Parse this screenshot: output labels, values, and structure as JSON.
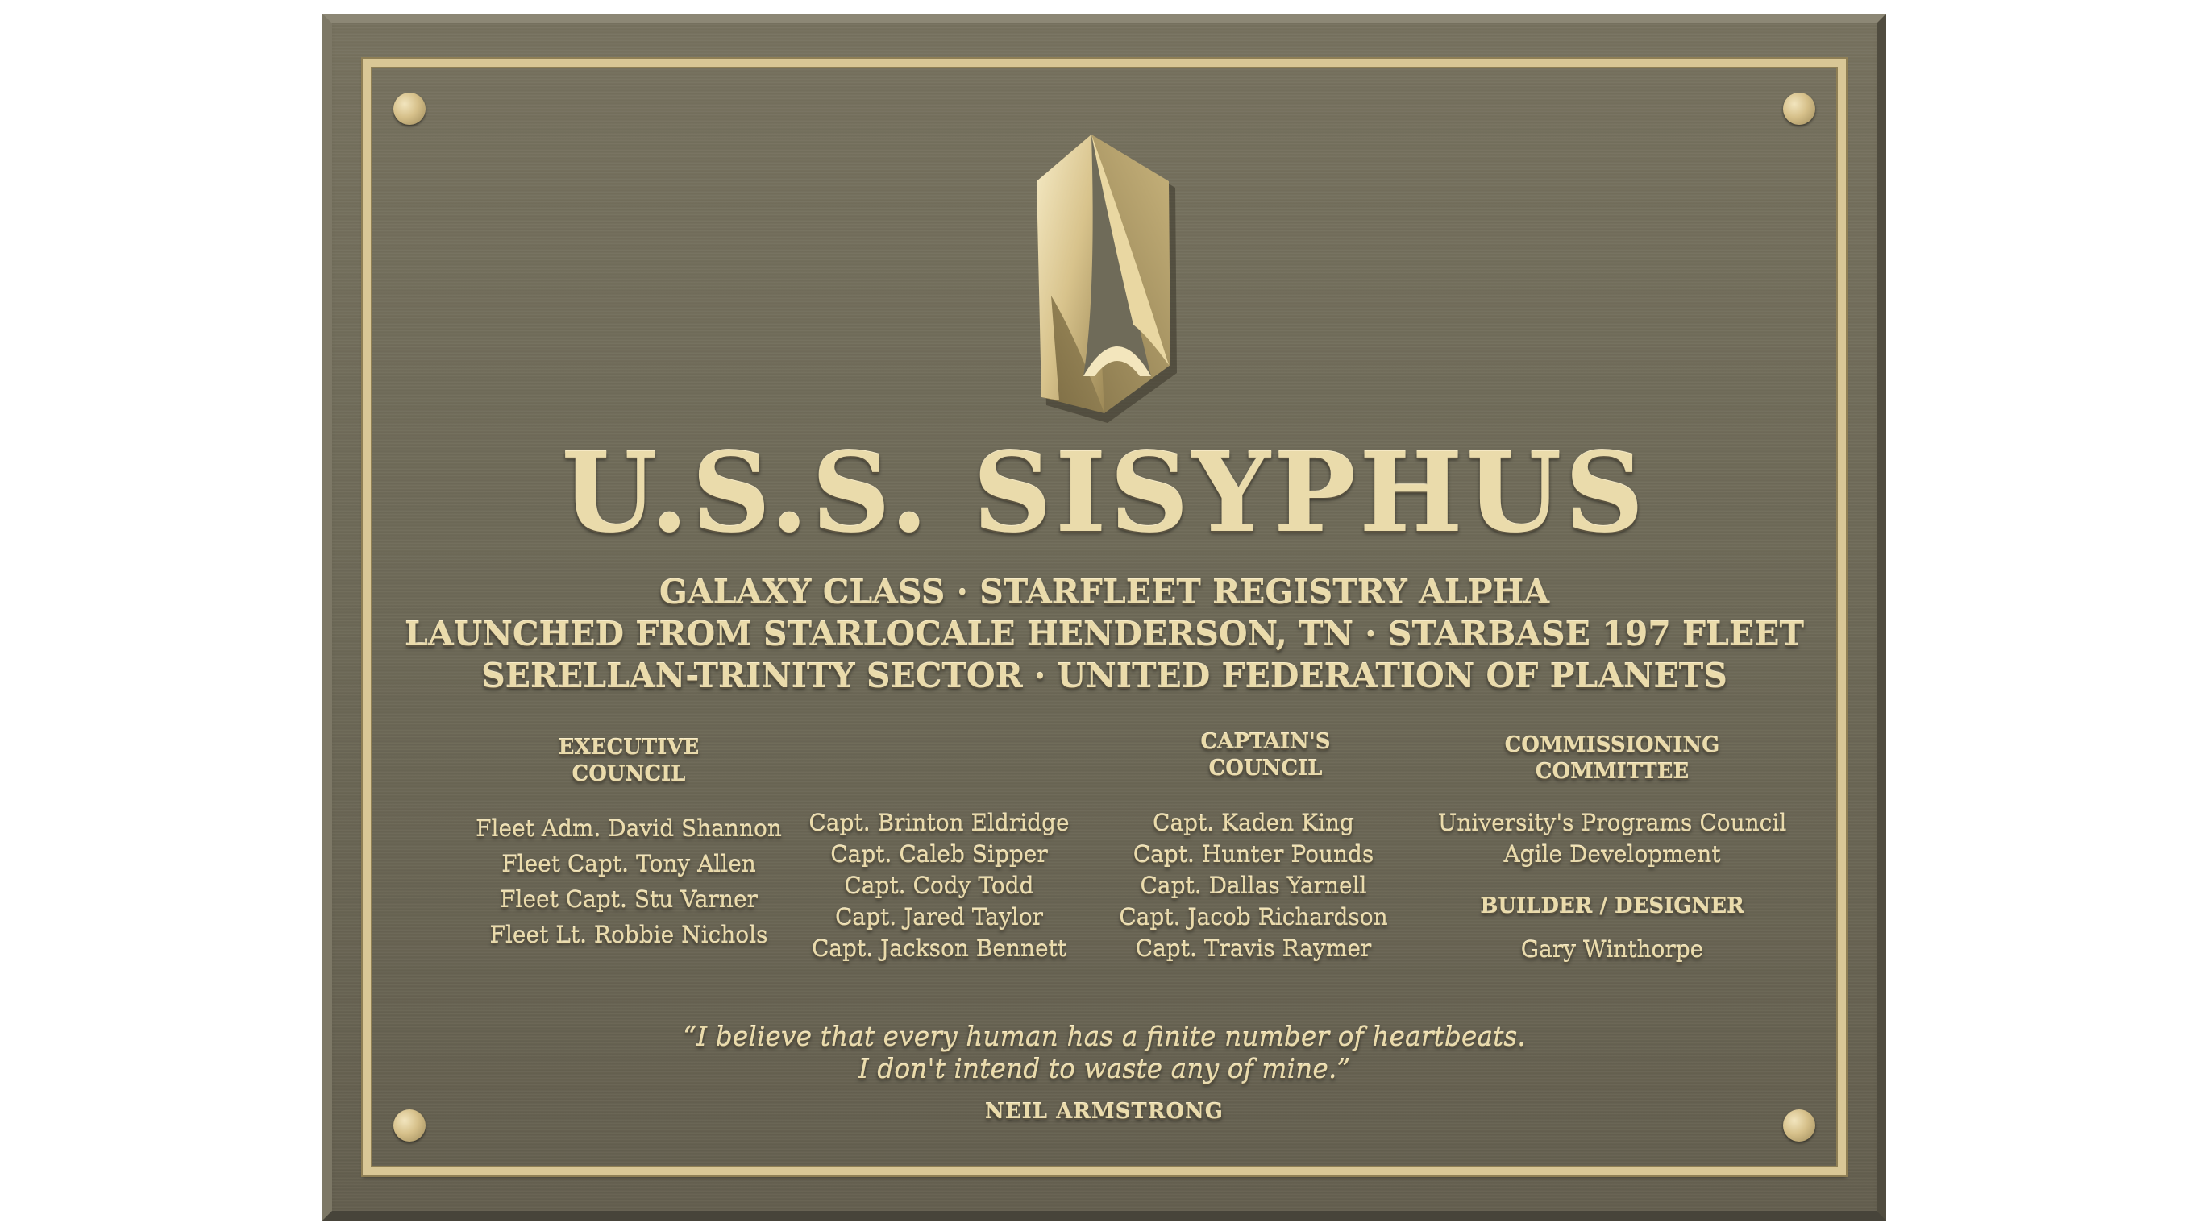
{
  "plaque": {
    "title": "U.S.S. SISYPHUS",
    "subtitle_lines": [
      "GALAXY CLASS · STARFLEET REGISTRY ALPHA",
      "LAUNCHED FROM STARLOCALE HENDERSON, TN · STARBASE 197 FLEET",
      "SERELLAN-TRINITY SECTOR · UNITED FEDERATION OF PLANETS"
    ],
    "emblem": "starfleet-delta-insignia",
    "colors": {
      "plate": "#6f6b59",
      "lettering": "#eadbab",
      "border": "#d9c796"
    }
  },
  "executive_council": {
    "heading": "EXECUTIVE\nCOUNCIL",
    "members": [
      "Fleet Adm. David Shannon",
      "Fleet Capt. Tony Allen",
      "Fleet Capt. Stu Varner",
      "Fleet Lt. Robbie Nichols"
    ]
  },
  "captains_council": {
    "heading": "CAPTAIN'S\nCOUNCIL",
    "members_left": [
      "Capt. Brinton Eldridge",
      "Capt. Caleb Sipper",
      "Capt. Cody Todd",
      "Capt. Jared Taylor",
      "Capt. Jackson Bennett"
    ],
    "members_right": [
      "Capt. Kaden King",
      "Capt. Hunter Pounds",
      "Capt. Dallas Yarnell",
      "Capt. Jacob Richardson",
      "Capt. Travis Raymer"
    ]
  },
  "commissioning_committee": {
    "heading": "COMMISSIONING\nCOMMITTEE",
    "members": [
      "University's Programs Council",
      "Agile Development"
    ],
    "builder_heading": "BUILDER / DESIGNER",
    "builder": "Gary Winthorpe"
  },
  "quote": {
    "line1": "“I believe that every human has a finite number of heartbeats.",
    "line2": "I don't intend to waste any of mine.”",
    "author": "NEIL ARMSTRONG"
  }
}
